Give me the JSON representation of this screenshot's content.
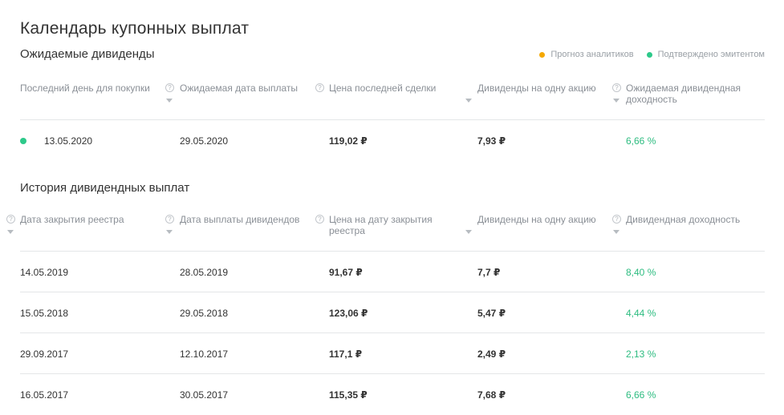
{
  "title": "Календарь купонных выплат",
  "expected": {
    "heading": "Ожидаемые дивиденды",
    "legend": [
      {
        "label": "Прогноз аналитиков",
        "color": "#f5a800"
      },
      {
        "label": "Подтверждено эмитентом",
        "color": "#2dc98a"
      }
    ],
    "columns": [
      "Последний день для покупки",
      "Ожидаемая дата выплаты",
      "Цена последней сделки",
      "Дивиденды на одну акцию",
      "Ожидаемая дивидендная доходность"
    ],
    "row": {
      "status_color": "#2dc98a",
      "last_day": "13.05.2020",
      "pay_date": "29.05.2020",
      "price": "119,02 ₽",
      "dividend": "7,93 ₽",
      "yield": "6,66 %"
    }
  },
  "history": {
    "heading": "История дивидендных выплат",
    "columns": [
      "Дата закрытия реестра",
      "Дата выплаты дивидендов",
      "Цена на дату закрытия реестра",
      "Дивиденды на одну акцию",
      "Дивидендная доходность"
    ],
    "rows": [
      {
        "close_date": "14.05.2019",
        "pay_date": "28.05.2019",
        "price": "91,67 ₽",
        "dividend": "7,7 ₽",
        "yield": "8,40 %"
      },
      {
        "close_date": "15.05.2018",
        "pay_date": "29.05.2018",
        "price": "123,06 ₽",
        "dividend": "5,47 ₽",
        "yield": "4,44 %"
      },
      {
        "close_date": "29.09.2017",
        "pay_date": "12.10.2017",
        "price": "117,1 ₽",
        "dividend": "2,49 ₽",
        "yield": "2,13 %"
      },
      {
        "close_date": "16.05.2017",
        "pay_date": "30.05.2017",
        "price": "115,35 ₽",
        "dividend": "7,68 ₽",
        "yield": "6,66 %"
      }
    ]
  },
  "icons": {
    "help": "question-mark-circle-icon",
    "sort": "sort-down-arrow-icon",
    "help_glyph": "?"
  }
}
